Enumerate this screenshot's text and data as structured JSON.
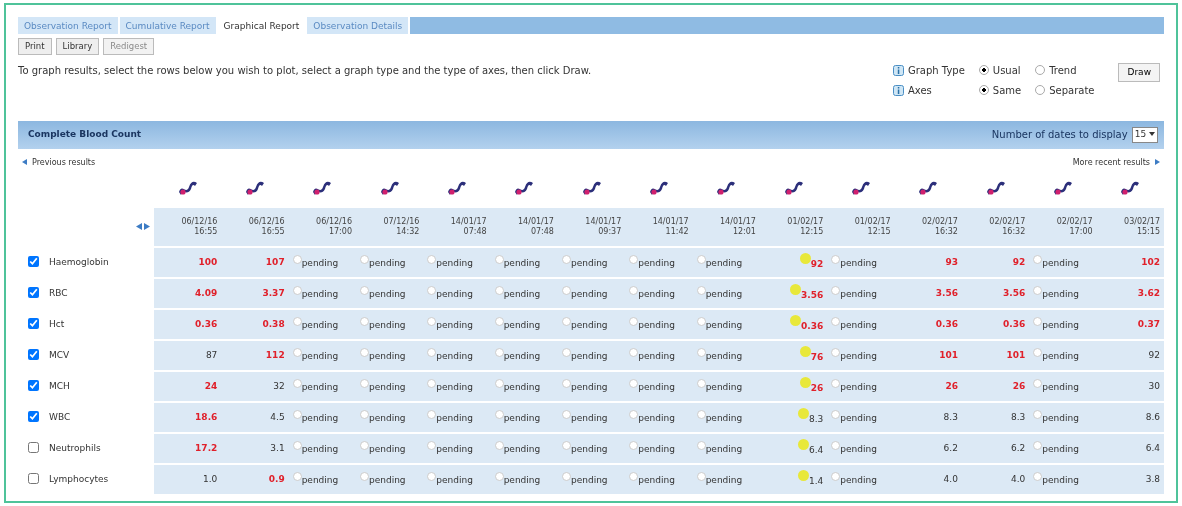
{
  "tabs": [
    {
      "label": "Observation Report",
      "selected": false
    },
    {
      "label": "Cumulative Report",
      "selected": false
    },
    {
      "label": "Graphical Report",
      "selected": true
    },
    {
      "label": "Observation Details",
      "selected": false
    }
  ],
  "toolbar": [
    {
      "label": "Print",
      "disabled": false
    },
    {
      "label": "Library",
      "disabled": false
    },
    {
      "label": "Redigest",
      "disabled": true
    }
  ],
  "instructions": "To graph results, select the rows below you wish to plot, select a graph type and the type of axes, then click Draw.",
  "options": [
    {
      "label": "Graph Type",
      "choices": [
        {
          "label": "Usual",
          "selected": true
        },
        {
          "label": "Trend",
          "selected": false
        }
      ]
    },
    {
      "label": "Axes",
      "choices": [
        {
          "label": "Same",
          "selected": true
        },
        {
          "label": "Separate",
          "selected": false
        }
      ]
    }
  ],
  "draw_button": "Draw",
  "section": {
    "title": "Complete Blood Count",
    "dates_label": "Number of dates to display",
    "dates_value": "15"
  },
  "previous_link": "Previous results",
  "recent_link": "More recent results",
  "dates": [
    [
      "06/12/16",
      "16:55"
    ],
    [
      "06/12/16",
      "16:55"
    ],
    [
      "06/12/16",
      "17:00"
    ],
    [
      "07/12/16",
      "14:32"
    ],
    [
      "14/01/17",
      "07:48"
    ],
    [
      "14/01/17",
      "07:48"
    ],
    [
      "14/01/17",
      "09:37"
    ],
    [
      "14/01/17",
      "11:42"
    ],
    [
      "14/01/17",
      "12:01"
    ],
    [
      "01/02/17",
      "12:15"
    ],
    [
      "01/02/17",
      "12:15"
    ],
    [
      "02/02/17",
      "16:32"
    ],
    [
      "02/02/17",
      "16:32"
    ],
    [
      "02/02/17",
      "17:00"
    ],
    [
      "03/02/17",
      "15:15"
    ]
  ],
  "rows": [
    {
      "name": "Haemoglobin",
      "checked": true,
      "cells": [
        {
          "kind": "value",
          "text": "100",
          "abnormal": true
        },
        {
          "kind": "value",
          "text": "107",
          "abnormal": true
        },
        {
          "kind": "pending",
          "text": "pending"
        },
        {
          "kind": "pending",
          "text": "pending"
        },
        {
          "kind": "pending",
          "text": "pending"
        },
        {
          "kind": "pending",
          "text": "pending"
        },
        {
          "kind": "pending",
          "text": "pending"
        },
        {
          "kind": "pending",
          "text": "pending"
        },
        {
          "kind": "pending",
          "text": "pending"
        },
        {
          "kind": "new",
          "text": "92",
          "abnormal": true
        },
        {
          "kind": "pending",
          "text": "pending"
        },
        {
          "kind": "value",
          "text": "93",
          "abnormal": true
        },
        {
          "kind": "value",
          "text": "92",
          "abnormal": true
        },
        {
          "kind": "pending",
          "text": "pending"
        },
        {
          "kind": "value",
          "text": "102",
          "abnormal": true
        }
      ]
    },
    {
      "name": "RBC",
      "checked": true,
      "cells": [
        {
          "kind": "value",
          "text": "4.09",
          "abnormal": true
        },
        {
          "kind": "value",
          "text": "3.37",
          "abnormal": true
        },
        {
          "kind": "pending",
          "text": "pending"
        },
        {
          "kind": "pending",
          "text": "pending"
        },
        {
          "kind": "pending",
          "text": "pending"
        },
        {
          "kind": "pending",
          "text": "pending"
        },
        {
          "kind": "pending",
          "text": "pending"
        },
        {
          "kind": "pending",
          "text": "pending"
        },
        {
          "kind": "pending",
          "text": "pending"
        },
        {
          "kind": "new",
          "text": "3.56",
          "abnormal": true
        },
        {
          "kind": "pending",
          "text": "pending"
        },
        {
          "kind": "value",
          "text": "3.56",
          "abnormal": true
        },
        {
          "kind": "value",
          "text": "3.56",
          "abnormal": true
        },
        {
          "kind": "pending",
          "text": "pending"
        },
        {
          "kind": "value",
          "text": "3.62",
          "abnormal": true
        }
      ]
    },
    {
      "name": "Hct",
      "checked": true,
      "cells": [
        {
          "kind": "value",
          "text": "0.36",
          "abnormal": true
        },
        {
          "kind": "value",
          "text": "0.38",
          "abnormal": true
        },
        {
          "kind": "pending",
          "text": "pending"
        },
        {
          "kind": "pending",
          "text": "pending"
        },
        {
          "kind": "pending",
          "text": "pending"
        },
        {
          "kind": "pending",
          "text": "pending"
        },
        {
          "kind": "pending",
          "text": "pending"
        },
        {
          "kind": "pending",
          "text": "pending"
        },
        {
          "kind": "pending",
          "text": "pending"
        },
        {
          "kind": "new",
          "text": "0.36",
          "abnormal": true
        },
        {
          "kind": "pending",
          "text": "pending"
        },
        {
          "kind": "value",
          "text": "0.36",
          "abnormal": true
        },
        {
          "kind": "value",
          "text": "0.36",
          "abnormal": true
        },
        {
          "kind": "pending",
          "text": "pending"
        },
        {
          "kind": "value",
          "text": "0.37",
          "abnormal": true
        }
      ]
    },
    {
      "name": "MCV",
      "checked": true,
      "cells": [
        {
          "kind": "value",
          "text": "87",
          "abnormal": false
        },
        {
          "kind": "value",
          "text": "112",
          "abnormal": true
        },
        {
          "kind": "pending",
          "text": "pending"
        },
        {
          "kind": "pending",
          "text": "pending"
        },
        {
          "kind": "pending",
          "text": "pending"
        },
        {
          "kind": "pending",
          "text": "pending"
        },
        {
          "kind": "pending",
          "text": "pending"
        },
        {
          "kind": "pending",
          "text": "pending"
        },
        {
          "kind": "pending",
          "text": "pending"
        },
        {
          "kind": "new",
          "text": "76",
          "abnormal": true
        },
        {
          "kind": "pending",
          "text": "pending"
        },
        {
          "kind": "value",
          "text": "101",
          "abnormal": true
        },
        {
          "kind": "value",
          "text": "101",
          "abnormal": true
        },
        {
          "kind": "pending",
          "text": "pending"
        },
        {
          "kind": "value",
          "text": "92",
          "abnormal": false
        }
      ]
    },
    {
      "name": "MCH",
      "checked": true,
      "cells": [
        {
          "kind": "value",
          "text": "24",
          "abnormal": true
        },
        {
          "kind": "value",
          "text": "32",
          "abnormal": false
        },
        {
          "kind": "pending",
          "text": "pending"
        },
        {
          "kind": "pending",
          "text": "pending"
        },
        {
          "kind": "pending",
          "text": "pending"
        },
        {
          "kind": "pending",
          "text": "pending"
        },
        {
          "kind": "pending",
          "text": "pending"
        },
        {
          "kind": "pending",
          "text": "pending"
        },
        {
          "kind": "pending",
          "text": "pending"
        },
        {
          "kind": "new",
          "text": "26",
          "abnormal": true
        },
        {
          "kind": "pending",
          "text": "pending"
        },
        {
          "kind": "value",
          "text": "26",
          "abnormal": true
        },
        {
          "kind": "value",
          "text": "26",
          "abnormal": true
        },
        {
          "kind": "pending",
          "text": "pending"
        },
        {
          "kind": "value",
          "text": "30",
          "abnormal": false
        }
      ]
    },
    {
      "name": "WBC",
      "checked": true,
      "cells": [
        {
          "kind": "value",
          "text": "18.6",
          "abnormal": true
        },
        {
          "kind": "value",
          "text": "4.5",
          "abnormal": false
        },
        {
          "kind": "pending",
          "text": "pending"
        },
        {
          "kind": "pending",
          "text": "pending"
        },
        {
          "kind": "pending",
          "text": "pending"
        },
        {
          "kind": "pending",
          "text": "pending"
        },
        {
          "kind": "pending",
          "text": "pending"
        },
        {
          "kind": "pending",
          "text": "pending"
        },
        {
          "kind": "pending",
          "text": "pending"
        },
        {
          "kind": "new",
          "text": "8.3",
          "abnormal": false
        },
        {
          "kind": "pending",
          "text": "pending"
        },
        {
          "kind": "value",
          "text": "8.3",
          "abnormal": false
        },
        {
          "kind": "value",
          "text": "8.3",
          "abnormal": false
        },
        {
          "kind": "pending",
          "text": "pending"
        },
        {
          "kind": "value",
          "text": "8.6",
          "abnormal": false
        }
      ]
    },
    {
      "name": "Neutrophils",
      "checked": false,
      "cells": [
        {
          "kind": "value",
          "text": "17.2",
          "abnormal": true
        },
        {
          "kind": "value",
          "text": "3.1",
          "abnormal": false
        },
        {
          "kind": "pending",
          "text": "pending"
        },
        {
          "kind": "pending",
          "text": "pending"
        },
        {
          "kind": "pending",
          "text": "pending"
        },
        {
          "kind": "pending",
          "text": "pending"
        },
        {
          "kind": "pending",
          "text": "pending"
        },
        {
          "kind": "pending",
          "text": "pending"
        },
        {
          "kind": "pending",
          "text": "pending"
        },
        {
          "kind": "new",
          "text": "6.4",
          "abnormal": false
        },
        {
          "kind": "pending",
          "text": "pending"
        },
        {
          "kind": "value",
          "text": "6.2",
          "abnormal": false
        },
        {
          "kind": "value",
          "text": "6.2",
          "abnormal": false
        },
        {
          "kind": "pending",
          "text": "pending"
        },
        {
          "kind": "value",
          "text": "6.4",
          "abnormal": false
        }
      ]
    },
    {
      "name": "Lymphocytes",
      "checked": false,
      "cells": [
        {
          "kind": "value",
          "text": "1.0",
          "abnormal": false
        },
        {
          "kind": "value",
          "text": "0.9",
          "abnormal": true
        },
        {
          "kind": "pending",
          "text": "pending"
        },
        {
          "kind": "pending",
          "text": "pending"
        },
        {
          "kind": "pending",
          "text": "pending"
        },
        {
          "kind": "pending",
          "text": "pending"
        },
        {
          "kind": "pending",
          "text": "pending"
        },
        {
          "kind": "pending",
          "text": "pending"
        },
        {
          "kind": "pending",
          "text": "pending"
        },
        {
          "kind": "new",
          "text": "1.4",
          "abnormal": false
        },
        {
          "kind": "pending",
          "text": "pending"
        },
        {
          "kind": "value",
          "text": "4.0",
          "abnormal": false
        },
        {
          "kind": "value",
          "text": "4.0",
          "abnormal": false
        },
        {
          "kind": "pending",
          "text": "pending"
        },
        {
          "kind": "value",
          "text": "3.8",
          "abnormal": false
        }
      ]
    }
  ]
}
